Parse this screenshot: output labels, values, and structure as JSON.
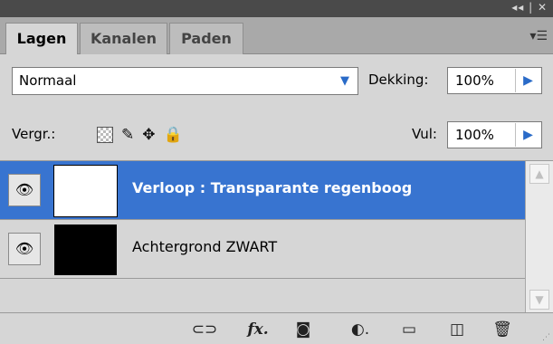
{
  "titlebar": {
    "buttons": "◂◂ | ✕"
  },
  "tabs": [
    {
      "label": "Lagen",
      "active": true
    },
    {
      "label": "Kanalen",
      "active": false
    },
    {
      "label": "Paden",
      "active": false
    }
  ],
  "panel_menu_icon": "panel-menu-icon",
  "blend_mode": {
    "value": "Normaal"
  },
  "opacity": {
    "label": "Dekking:",
    "value": "100%"
  },
  "lock": {
    "label": "Vergr.:"
  },
  "fill": {
    "label": "Vul:",
    "value": "100%"
  },
  "layers": [
    {
      "name": "Verloop : Transparante regenboog",
      "selected": true,
      "thumbnail_color": "#ffffff"
    },
    {
      "name": "Achtergrond ZWART",
      "selected": false,
      "thumbnail_color": "#000000"
    }
  ],
  "colors": {
    "selection": "#3874d0",
    "panel_bg": "#d6d6d6",
    "titlebar": "#4a4a4a"
  }
}
